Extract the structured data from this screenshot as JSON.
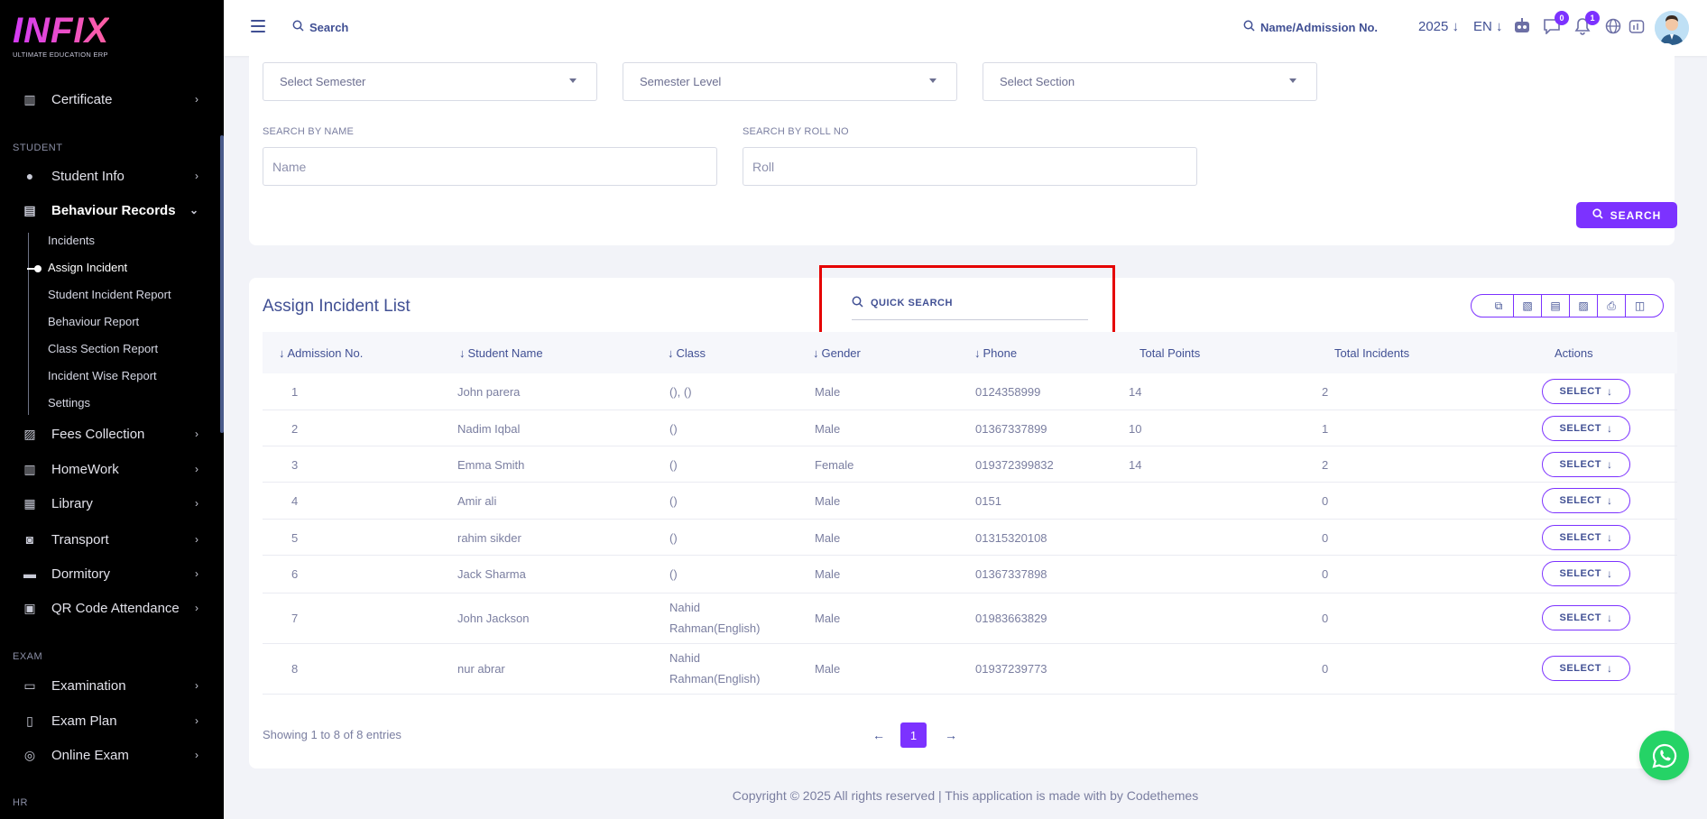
{
  "brand": {
    "logo": "INFIX",
    "tagline": "ULTIMATE EDUCATION ERP"
  },
  "sidebar": {
    "certificate": "Certificate",
    "section_student": "STUDENT",
    "student_info": "Student Info",
    "behaviour_records": "Behaviour Records",
    "sub_items": [
      "Incidents",
      "Assign Incident",
      "Student Incident Report",
      "Behaviour Report",
      "Class Section Report",
      "Incident Wise Report",
      "Settings"
    ],
    "fees_collection": "Fees Collection",
    "homework": "HomeWork",
    "library": "Library",
    "transport": "Transport",
    "dormitory": "Dormitory",
    "qr_attendance": "QR Code Attendance",
    "section_exam": "EXAM",
    "examination": "Examination",
    "exam_plan": "Exam Plan",
    "online_exam": "Online Exam",
    "section_hr": "HR"
  },
  "header": {
    "search": "Search",
    "search_right": "Name/Admission No.",
    "year": "2025",
    "lang": "EN",
    "chat_badge": "0",
    "notif_badge": "1",
    "icons": [
      "robot-icon",
      "chat-icon",
      "bell-icon",
      "globe-icon",
      "dashboard-icon"
    ]
  },
  "filters": {
    "semester": "Select Semester",
    "semester_level": "Semester Level",
    "section": "Select Section",
    "name_label": "SEARCH BY NAME",
    "name_placeholder": "Name",
    "roll_label": "SEARCH BY ROLL NO",
    "roll_placeholder": "Roll",
    "search_button": "SEARCH"
  },
  "list": {
    "title": "Assign Incident List",
    "quick_search": "QUICK SEARCH",
    "columns": [
      "Admission No.",
      "Student Name",
      "Class",
      "Gender",
      "Phone",
      "Total Points",
      "Total Incidents",
      "Actions"
    ],
    "action_label": "SELECT",
    "rows": [
      {
        "adm": "1",
        "name": "John parera",
        "class": "(), ()",
        "class2": "",
        "gender": "Male",
        "phone": "0124358999",
        "points": "14",
        "incidents": "2"
      },
      {
        "adm": "2",
        "name": "Nadim Iqbal",
        "class": "()",
        "class2": "",
        "gender": "Male",
        "phone": "01367337899",
        "points": "10",
        "incidents": "1"
      },
      {
        "adm": "3",
        "name": "Emma Smith",
        "class": "()",
        "class2": "",
        "gender": "Female",
        "phone": "019372399832",
        "points": "14",
        "incidents": "2"
      },
      {
        "adm": "4",
        "name": "Amir ali",
        "class": "()",
        "class2": "",
        "gender": "Male",
        "phone": "0151",
        "points": "",
        "incidents": "0"
      },
      {
        "adm": "5",
        "name": "rahim sikder",
        "class": "()",
        "class2": "",
        "gender": "Male",
        "phone": "01315320108",
        "points": "",
        "incidents": "0"
      },
      {
        "adm": "6",
        "name": "Jack Sharma",
        "class": "()",
        "class2": "",
        "gender": "Male",
        "phone": "01367337898",
        "points": "",
        "incidents": "0"
      },
      {
        "adm": "7",
        "name": "John Jackson",
        "class": "Nahid",
        "class2": "Rahman(English)",
        "gender": "Male",
        "phone": "01983663829",
        "points": "",
        "incidents": "0"
      },
      {
        "adm": "8",
        "name": "nur abrar",
        "class": "Nahid",
        "class2": "Rahman(English)",
        "gender": "Male",
        "phone": "01937239773",
        "points": "",
        "incidents": "0"
      }
    ],
    "showing": "Showing 1 to 8 of 8 entries",
    "current_page": "1"
  },
  "footer": "Copyright © 2025 All rights reserved | This application is made with by Codethemes",
  "colors": {
    "accent": "#7c32ff",
    "text": "#415094",
    "highlight": "#e50000",
    "whatsapp": "#25d366"
  }
}
